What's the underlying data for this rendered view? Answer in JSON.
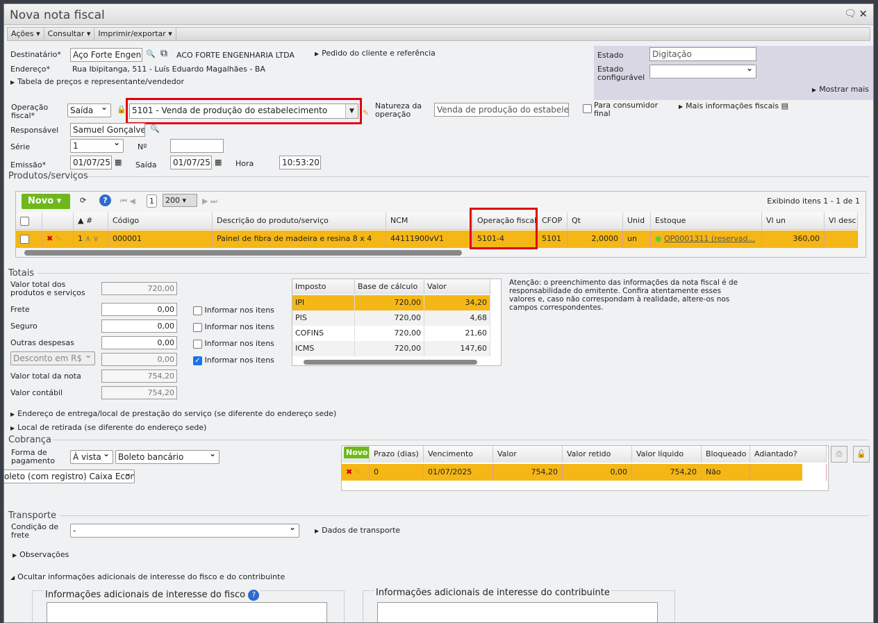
{
  "window": {
    "title": "Nova nota fiscal"
  },
  "menu": [
    "Ações",
    "Consultar",
    "Imprimir/exportar"
  ],
  "header": {
    "destinatario_label": "Destinatário*",
    "destinatario_value": "Aço Forte Engenha",
    "destinatario_name": "ACO FORTE ENGENHARIA LTDA",
    "pedido_link": "Pedido do cliente e referência",
    "endereco_label": "Endereço*",
    "endereco_value": "Rua Ibipitanga, 511 - Luís Eduardo Magalhães - BA",
    "tabela_link": "Tabela de preços e representante/vendedor",
    "estado_label": "Estado",
    "estado_value": "Digitação",
    "estado_config_label": "Estado configurável",
    "estado_config_value": "",
    "mostrar_mais": "Mostrar mais",
    "operacao_label": "Operação fiscal*",
    "operacao_tipo": "Saída",
    "operacao_value": "5101 - Venda de produção do estabelecimento",
    "natureza_label": "Natureza da operação",
    "natureza_value": "Venda de produção do estabelecime",
    "consumidor_label": "Para consumidor final",
    "mais_info": "Mais informações fiscais",
    "responsavel_label": "Responsável",
    "responsavel_value": "Samuel Gonçalves",
    "serie_label": "Série",
    "serie_value": "1",
    "numero_label": "Nº",
    "numero_value": "",
    "emissao_label": "Emissão*",
    "emissao_value": "01/07/25",
    "saida_label": "Saída",
    "saida_value": "01/07/25",
    "hora_label": "Hora",
    "hora_value": "10:53:20"
  },
  "produtos": {
    "section": "Produtos/serviços",
    "novo": "Novo",
    "page": "1",
    "page_size": "200",
    "exibindo": "Exibindo itens 1 - 1 de 1",
    "columns": [
      "#",
      "Código",
      "Descrição do produto/serviço",
      "NCM",
      "Operação fiscal",
      "CFOP",
      "Qt",
      "Unid",
      "Estoque",
      "Vl un",
      "Vl desc"
    ],
    "rows": [
      {
        "num": "1",
        "codigo": "000001",
        "descricao": "Painel de fibra de madeira e resina 8 x 4",
        "ncm": "44111900vV1",
        "operacao": "5101-4",
        "cfop": "5101",
        "qt": "2,0000",
        "unid": "un",
        "estoque": "OP0001311 (reservad...",
        "vl_un": "360,00",
        "vl_desc": ""
      }
    ]
  },
  "totais": {
    "section": "Totais",
    "fields": [
      {
        "label": "Valor total dos produtos e serviços",
        "value": "720,00"
      },
      {
        "label": "Frete",
        "value": "0,00",
        "check": "Informar nos itens",
        "checked": false
      },
      {
        "label": "Seguro",
        "value": "0,00",
        "check": "Informar nos itens",
        "checked": false
      },
      {
        "label": "Outras despesas",
        "value": "0,00",
        "check": "Informar nos itens",
        "checked": false
      },
      {
        "label": "Desconto em R$",
        "value": "0,00",
        "check": "Informar nos itens",
        "checked": true
      },
      {
        "label": "Valor total da nota",
        "value": "754,20"
      },
      {
        "label": "Valor contábil",
        "value": "754,20"
      }
    ],
    "tax_columns": [
      "Imposto",
      "Base de cálculo",
      "Valor"
    ],
    "taxes": [
      [
        "IPI",
        "720,00",
        "34,20"
      ],
      [
        "PIS",
        "720,00",
        "4,68"
      ],
      [
        "COFINS",
        "720,00",
        "21,60"
      ],
      [
        "ICMS",
        "720,00",
        "147,60"
      ]
    ],
    "notice": "Atenção: o preenchimento das informações da nota fiscal é de responsabilidade do emitente. Confira atentamente esses valores e, caso não correspondam à realidade, altere-os nos campos correspondentes."
  },
  "links": {
    "entrega": "Endereço de entrega/local de prestação do serviço (se diferente do endereço sede)",
    "retirada": "Local de retirada (se diferente do endereço sede)"
  },
  "cobranca": {
    "section": "Cobrança",
    "forma_label": "Forma de pagamento",
    "forma_prazo": "À vista",
    "forma_tipo": "Boleto bancário",
    "conta": "oleto (com registro) Caixa Econ",
    "novo": "Novo",
    "columns": [
      "Prazo (dias)",
      "Vencimento",
      "Valor",
      "Valor retido",
      "Valor líquido",
      "Bloqueado",
      "Adiantado?"
    ],
    "rows": [
      [
        "0",
        "01/07/2025",
        "754,20",
        "0,00",
        "754,20",
        "Não",
        ""
      ]
    ]
  },
  "transporte": {
    "section": "Transporte",
    "condicao_label": "Condição de frete",
    "condicao_value": "-",
    "dados": "Dados de transporte"
  },
  "observacoes": "Observações",
  "ocultar": "Ocultar informações adicionais de interesse do fisco e do contribuinte",
  "info_fisco": "Informações adicionais de interesse do fisco",
  "info_contribuinte": "Informações adicionais de interesse do contribuinte"
}
